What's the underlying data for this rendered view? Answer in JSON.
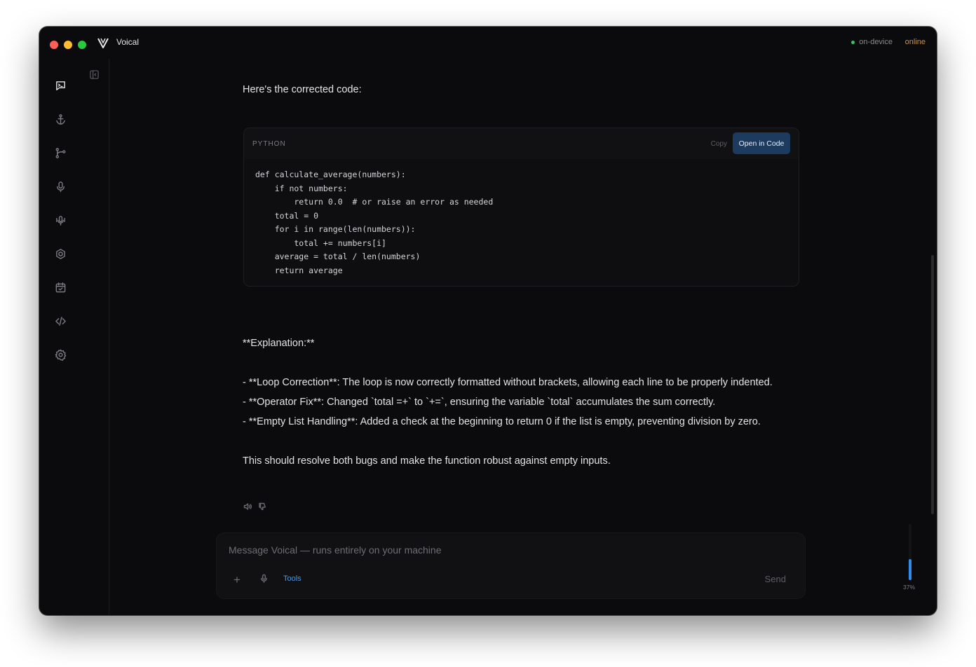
{
  "app": {
    "title": "Voical"
  },
  "status": {
    "local_label": "on-device",
    "network_label": "online"
  },
  "sidebar": {
    "items": [
      {
        "icon": "chat-icon",
        "active": true
      },
      {
        "icon": "anchor-icon"
      },
      {
        "icon": "branch-icon"
      },
      {
        "icon": "microphone-icon"
      },
      {
        "icon": "voice-broadcast-icon"
      },
      {
        "icon": "hexagon-plugin-icon"
      },
      {
        "icon": "calendar-icon"
      },
      {
        "icon": "code-icon"
      },
      {
        "icon": "gear-icon"
      }
    ]
  },
  "message": {
    "intro": "Here's the corrected code:",
    "code": {
      "language": "PYTHON",
      "copy_label": "Copy",
      "open_label": "Open in Code",
      "content": "def calculate_average(numbers):\n    if not numbers:\n        return 0.0  # or raise an error as needed\n    total = 0\n    for i in range(len(numbers)):\n        total += numbers[i]\n    average = total / len(numbers)\n    return average"
    },
    "explanation_heading": "**Explanation:**",
    "bullets": [
      "- **Loop Correction**: The loop is now correctly formatted without brackets, allowing each line to be properly indented.",
      "- **Operator Fix**: Changed `total =+` to `+=`, ensuring the variable `total` accumulates the sum correctly.",
      "- **Empty List Handling**: Added a check at the beginning to return 0 if the list is empty, preventing division by zero."
    ],
    "closing": "This should resolve both bugs and make the function robust against empty inputs."
  },
  "composer": {
    "placeholder": "Message Voical — runs entirely on your machine",
    "plus_label": "+",
    "tools_label": "Tools",
    "send_label": "Send"
  },
  "mic_level": {
    "percent": 37,
    "label": "37%"
  },
  "colors": {
    "accent": "#2f8df0",
    "online": "#c9924a",
    "status_dot": "#35c46b",
    "open_button": "#1c3b5f"
  }
}
